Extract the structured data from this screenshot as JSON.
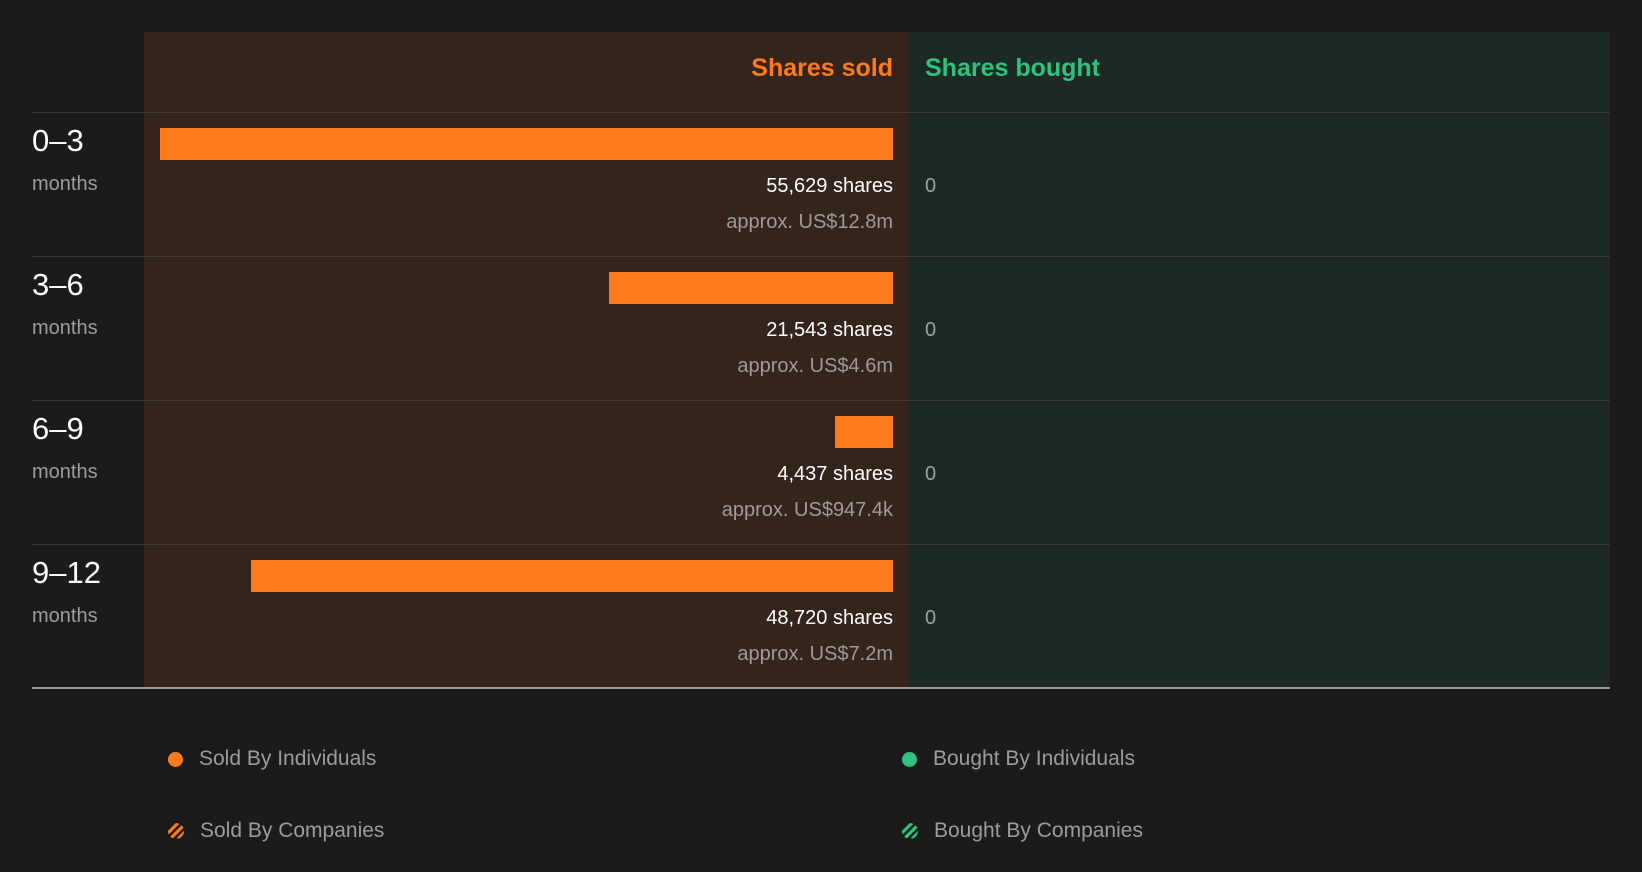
{
  "colors": {
    "sold": "#ff7a1a",
    "bought": "#2ec27e"
  },
  "headers": {
    "sold": "Shares sold",
    "bought": "Shares bought"
  },
  "legend": {
    "sold_individuals": "Sold By Individuals",
    "bought_individuals": "Bought By Individuals",
    "sold_companies": "Sold By Companies",
    "bought_companies": "Bought By Companies"
  },
  "chart_data": {
    "type": "bar",
    "categories": [
      "0–3",
      "3–6",
      "6–9",
      "9–12"
    ],
    "category_unit": "months",
    "series": [
      {
        "name": "Shares sold",
        "values": [
          55629,
          21543,
          4437,
          48720
        ],
        "labels": [
          "55,629 shares",
          "21,543 shares",
          "4,437 shares",
          "48,720 shares"
        ],
        "approx": [
          "approx. US$12.8m",
          "approx. US$4.6m",
          "approx. US$947.4k",
          "approx. US$7.2m"
        ]
      },
      {
        "name": "Shares bought",
        "values": [
          0,
          0,
          0,
          0
        ],
        "labels": [
          "0",
          "0",
          "0",
          "0"
        ]
      }
    ]
  }
}
